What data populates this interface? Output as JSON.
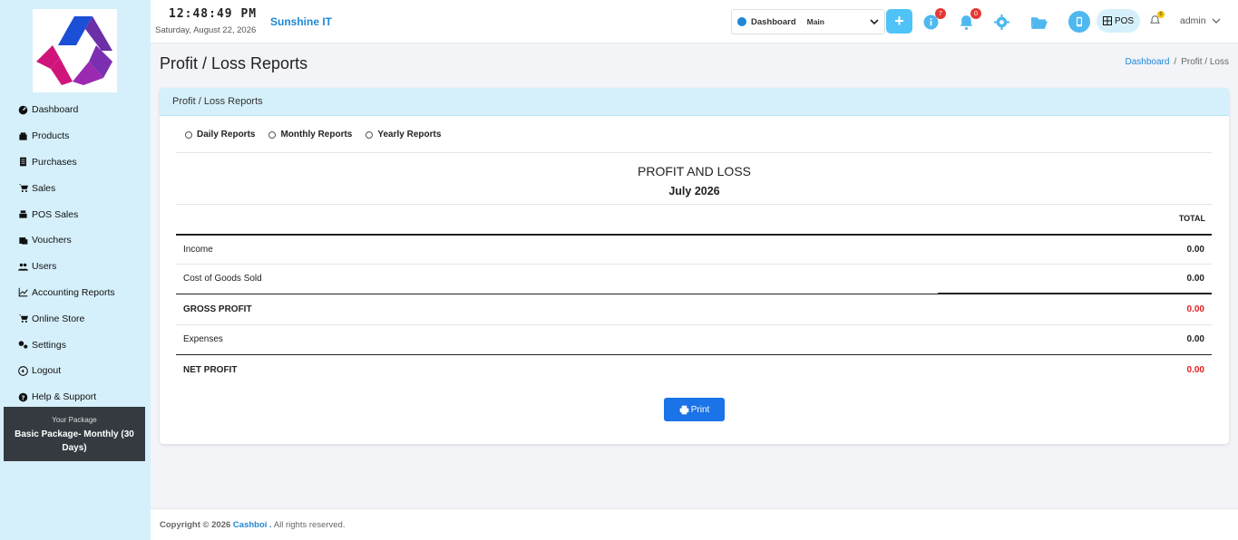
{
  "header": {
    "time": "12:48:49 PM",
    "date": "Saturday, August 22, 2026",
    "company": "Sunshine IT",
    "dashboard_label": "Dashboard",
    "dashboard_value": "Main",
    "badge_info": "7",
    "badge_notifications": "0",
    "pos_label": "POS",
    "alert_badge": "0",
    "user": "admin"
  },
  "sidebar": {
    "items": [
      {
        "label": "Dashboard",
        "icon": "dashboard-icon"
      },
      {
        "label": "Products",
        "icon": "box-icon"
      },
      {
        "label": "Purchases",
        "icon": "document-icon"
      },
      {
        "label": "Sales",
        "icon": "cart-icon"
      },
      {
        "label": "POS Sales",
        "icon": "register-icon"
      },
      {
        "label": "Vouchers",
        "icon": "voucher-icon"
      },
      {
        "label": "Users",
        "icon": "users-icon"
      },
      {
        "label": "Accounting Reports",
        "icon": "chart-line-icon"
      },
      {
        "label": "Online Store",
        "icon": "store-cart-icon"
      },
      {
        "label": "Settings",
        "icon": "gears-icon"
      },
      {
        "label": "Logout",
        "icon": "logout-icon"
      },
      {
        "label": "Help & Support",
        "icon": "question-icon"
      }
    ],
    "package_label": "Your Package",
    "package_name": "Basic Package- Monthly (30 Days)"
  },
  "page": {
    "title": "Profit / Loss Reports",
    "breadcrumb_link": "Dashboard",
    "breadcrumb_current": "Profit / Loss"
  },
  "card": {
    "header": "Profit / Loss Reports",
    "radios": [
      "Daily Reports",
      "Monthly Reports",
      "Yearly Reports"
    ],
    "report_title": "PROFIT AND LOSS",
    "report_period": "July 2026",
    "total_header": "TOTAL",
    "rows": [
      {
        "label": "Income",
        "amount": "0.00"
      },
      {
        "label": "Cost of Goods Sold",
        "amount": "0.00"
      },
      {
        "label": "GROSS PROFIT",
        "amount": "0.00"
      },
      {
        "label": "Expenses",
        "amount": "0.00"
      },
      {
        "label": "NET PROFIT",
        "amount": "0.00"
      }
    ],
    "print_label": "Print"
  },
  "footer": {
    "copyright": "Copyright © 2026",
    "brand": "Cashboi .",
    "rights": " All rights reserved."
  },
  "colors": {
    "accent": "#1f87d6",
    "sidebar_bg": "#d6f0fb",
    "negative": "#e02020",
    "print_button": "#1a73e8"
  }
}
